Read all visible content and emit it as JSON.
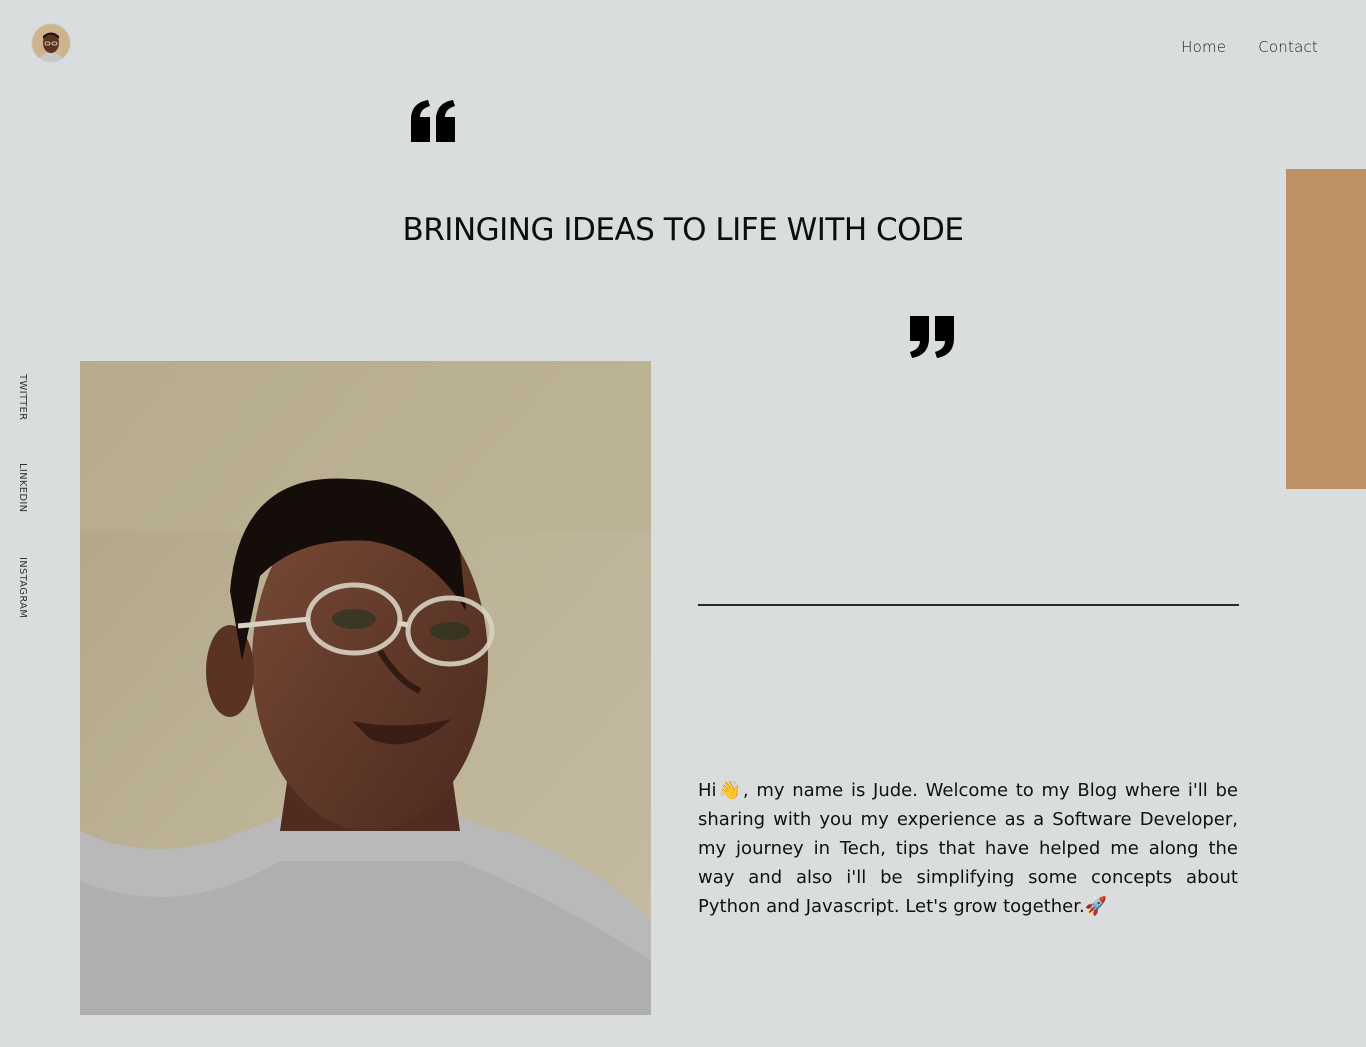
{
  "header": {
    "avatar_alt": "Jude avatar",
    "nav": [
      {
        "label": "Home"
      },
      {
        "label": "Contact"
      }
    ]
  },
  "hero": {
    "headline": "BRINGING IDEAS TO LIFE WITH CODE"
  },
  "social": [
    {
      "label": "TWITTER"
    },
    {
      "label": "LINKEDIN"
    },
    {
      "label": "INSTAGRAM"
    }
  ],
  "photo": {
    "alt": "Portrait of Jude wearing clear glasses and a grey t-shirt"
  },
  "bio": {
    "text": "Hi👋, my name is Jude. Welcome to my Blog where i'll be sharing with you my experience as a Software Developer, my journey in Tech, tips that have helped me along the way and also i'll be simplifying some concepts about Python and Javascript. Let's grow together.🚀"
  },
  "colors": {
    "background": "#dadddd",
    "accent": "#bd9066",
    "text": "#111111"
  },
  "icons": {
    "open_quote": "open-quote-icon",
    "close_quote": "close-quote-icon"
  }
}
